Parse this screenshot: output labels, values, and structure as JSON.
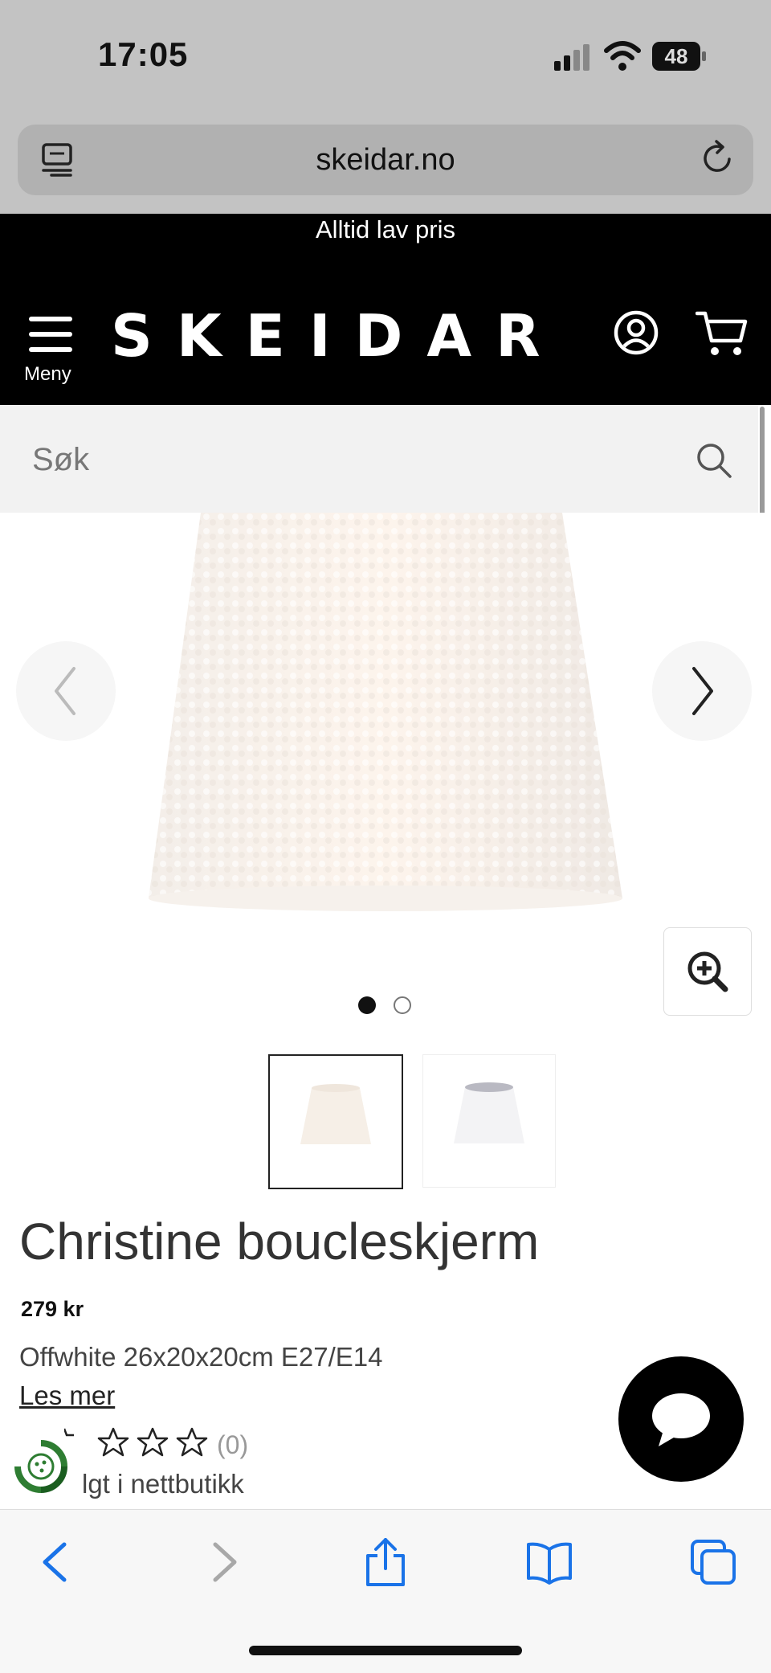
{
  "status_bar": {
    "time": "17:05",
    "battery": "48"
  },
  "browser": {
    "url": "skeidar.no"
  },
  "header": {
    "promo": "Alltid lav pris",
    "menu_label": "Meny",
    "logo": "SKEIDAR"
  },
  "search": {
    "placeholder": "Søk"
  },
  "gallery": {
    "active_image": 1,
    "image_count": 2
  },
  "product": {
    "title": "Christine boucleskjerm",
    "price": "279 kr",
    "variant": "Offwhite 26x20x20cm E27/E14",
    "read_more": "Les mer",
    "rating_count": "(0)",
    "stock_text": "lgt i nettbutikk"
  },
  "colors": {
    "header_bg": "#000000",
    "safari_blue": "#1a73e8",
    "eco_green": "#2e7d32"
  },
  "icons": [
    "tabs-icon",
    "reload-icon",
    "menu-icon",
    "user-icon",
    "cart-icon",
    "search-icon",
    "chevron-left-icon",
    "chevron-right-icon",
    "zoom-in-icon",
    "star-icon",
    "chat-icon",
    "back-icon",
    "forward-icon",
    "share-icon",
    "bookmarks-icon",
    "tabs-overview-icon"
  ]
}
